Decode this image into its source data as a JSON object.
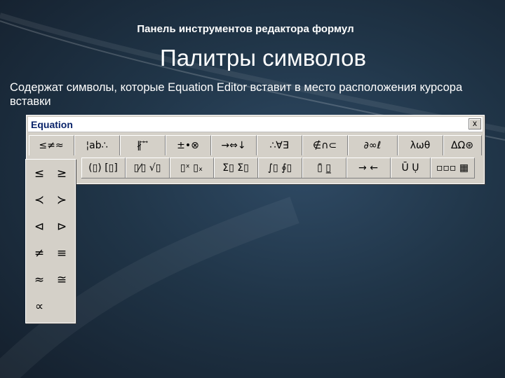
{
  "slide": {
    "subtitle": "Панель инструментов редактора формул",
    "title": "Палитры символов",
    "body": "Содержат символы, которые Equation Editor вставит в место расположения курсора вставки"
  },
  "toolbar": {
    "window_title": "Equation",
    "close_label": "x",
    "row1": [
      {
        "name": "relational-symbols-button",
        "label": "≤≠≈"
      },
      {
        "name": "spaces-ellipses-button",
        "label": "¦ab∴"
      },
      {
        "name": "embellishments-button",
        "label": "∦ ⃗ ⃗"
      },
      {
        "name": "operator-symbols-button",
        "label": "±•⊗"
      },
      {
        "name": "arrow-symbols-button",
        "label": "→⇔↓"
      },
      {
        "name": "logical-symbols-button",
        "label": "∴∀∃"
      },
      {
        "name": "set-theory-symbols-button",
        "label": "∉∩⊂"
      },
      {
        "name": "misc-symbols-button",
        "label": "∂∞ℓ"
      },
      {
        "name": "greek-lowercase-button",
        "label": "λωθ"
      },
      {
        "name": "greek-uppercase-button",
        "label": "ΔΩ⊛"
      }
    ],
    "row2": [
      {
        "name": "fence-templates-button",
        "label": "(▯) [▯]"
      },
      {
        "name": "fraction-radical-templates-button",
        "label": "▯⁄▯ √▯"
      },
      {
        "name": "subscript-superscript-templates-button",
        "label": "▯ˣ ▯ₓ"
      },
      {
        "name": "summation-templates-button",
        "label": "Σ▯ Σ▯"
      },
      {
        "name": "integral-templates-button",
        "label": "∫▯ ∮▯"
      },
      {
        "name": "underbar-overbar-templates-button",
        "label": "▯̄ ▯̲"
      },
      {
        "name": "labeled-arrow-templates-button",
        "label": "→ ←"
      },
      {
        "name": "products-set-theory-templates-button",
        "label": "Ū Ụ"
      },
      {
        "name": "matrix-templates-button",
        "label": "▫▫▫ ▦"
      }
    ]
  },
  "palette": {
    "symbols": [
      "≤",
      "≥",
      "≺",
      "≻",
      "⊲",
      "⊳",
      "≠",
      "≡",
      "≈",
      "≅",
      "∝"
    ]
  }
}
